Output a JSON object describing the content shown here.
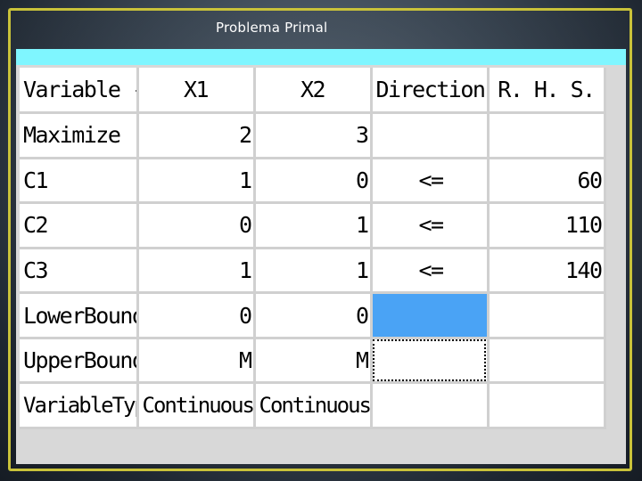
{
  "title": "Problema Primal",
  "table": {
    "headers": [
      "Variable -->",
      "X1",
      "X2",
      "Direction",
      "R. H. S."
    ],
    "rows": [
      [
        "Maximize",
        "2",
        "3",
        "",
        ""
      ],
      [
        "C1",
        "1",
        "0",
        "<=",
        "60"
      ],
      [
        "C2",
        "0",
        "1",
        "<=",
        "110"
      ],
      [
        "C3",
        "1",
        "1",
        "<=",
        "140"
      ],
      [
        "LowerBound",
        "0",
        "0",
        "",
        ""
      ],
      [
        "UpperBound",
        "M",
        "M",
        "",
        ""
      ],
      [
        "VariableType",
        "Continuous",
        "Continuous",
        "",
        ""
      ]
    ]
  },
  "colors": {
    "accent_bar": "#7ff6ff",
    "frame": "#c9c23a",
    "selected_cell": "#4aa3f5"
  }
}
